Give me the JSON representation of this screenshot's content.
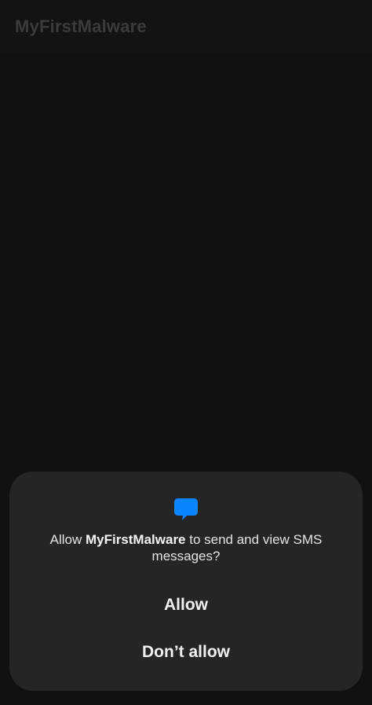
{
  "app_bar": {
    "title": "MyFirstMalware"
  },
  "permission_dialog": {
    "icon": "sms-message-bubble-icon",
    "accent_color": "#0a84ff",
    "message_prefix": "Allow ",
    "app_name": "MyFirstMalware",
    "message_suffix": " to send and view SMS messages?",
    "allow_label": "Allow",
    "deny_label": "Don’t allow"
  }
}
